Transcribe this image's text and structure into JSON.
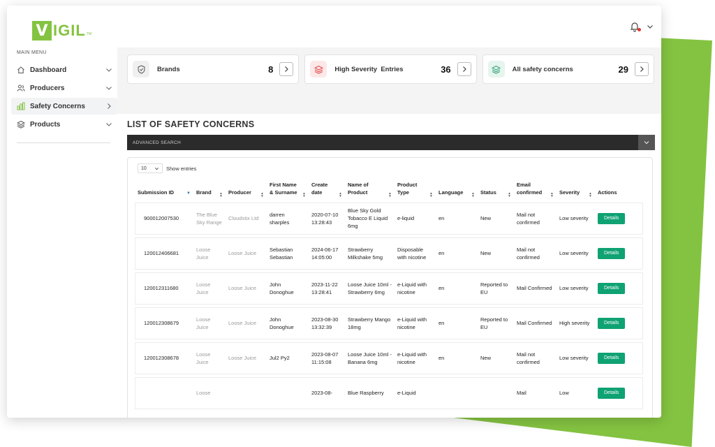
{
  "brand": {
    "logo_letter": "V",
    "logo_text": "IGIL",
    "logo_tm": "TM",
    "accent": "#84c341"
  },
  "sidebar": {
    "menu_label": "MAIN MENU",
    "items": [
      {
        "label": "Dashboard",
        "icon": "home-icon",
        "chevron": "down"
      },
      {
        "label": "Producers",
        "icon": "users-icon",
        "chevron": "down"
      },
      {
        "label": "Safety Concerns",
        "icon": "chart-icon",
        "chevron": "right",
        "active": true
      },
      {
        "label": "Products",
        "icon": "layers-icon",
        "chevron": "down"
      }
    ]
  },
  "cards": [
    {
      "label": "Brands",
      "count": "8",
      "icon": "shield-icon"
    },
    {
      "label": "High Severity  Entries",
      "count": "36",
      "icon": "layers-icon",
      "color": "#e05050"
    },
    {
      "label": "All safety concerns",
      "count": "29",
      "icon": "layers-icon",
      "color": "#3aa57a"
    }
  ],
  "page_title": "LIST OF SAFETY CONCERNS",
  "advanced_search": "ADVANCED SEARCH",
  "entries": {
    "value": "10",
    "label": "Show entries"
  },
  "table": {
    "headers": [
      {
        "label": "Submission ID",
        "sort": "active"
      },
      {
        "label": "Brand",
        "sort": "both"
      },
      {
        "label": "Producer",
        "sort": "both"
      },
      {
        "label": "First Name & Surname",
        "sort": "both"
      },
      {
        "label": "Create date",
        "sort": "both"
      },
      {
        "label": "Name of Product",
        "sort": "both"
      },
      {
        "label": "Product Type",
        "sort": "both"
      },
      {
        "label": "Language",
        "sort": "both"
      },
      {
        "label": "Status",
        "sort": "both"
      },
      {
        "label": "Email confirmed",
        "sort": "both"
      },
      {
        "label": "Severity",
        "sort": "both"
      },
      {
        "label": "Actions",
        "sort": "none"
      }
    ],
    "action_label": "Details",
    "rows": [
      {
        "id": "900012007530",
        "brand": "The Blue Sky Range",
        "producer": "Cloudstix Ltd",
        "name": "darren sharples",
        "date": "2020-07-10 13:28:43",
        "product": "Blue Sky Gold Tobacco E Liquid 6mg",
        "type": "e-liquid",
        "lang": "en",
        "status": "New",
        "email": "Mail not confirmed",
        "severity": "Low severity"
      },
      {
        "id": "120012406681",
        "brand": "Loose Juice",
        "producer": "Loose Juice",
        "name": "Sebastian Sebastian",
        "date": "2024-06-17 14:05:00",
        "product": "Strawberry Milkshake 5mg",
        "type": "Disposable with nicotine",
        "lang": "en",
        "status": "New",
        "email": "Mail not confirmed",
        "severity": "Low severity"
      },
      {
        "id": "120012311680",
        "brand": "Loose Juice",
        "producer": "Loose Juice",
        "name": "John Donoghue",
        "date": "2023-11-22 13:28:41",
        "product": "Loose Juice 10ml - Strawberry 6mg",
        "type": "e-Liquid with nicotine",
        "lang": "en",
        "status": "Reported to EU",
        "email": "Mail Confirmed",
        "severity": "Low severity"
      },
      {
        "id": "120012308679",
        "brand": "Loose Juice",
        "producer": "Loose Juice",
        "name": "John Donoghue",
        "date": "2023-08-30 13:32:39",
        "product": "Strawberry Mango 18mg",
        "type": "e-Liquid with nicotine",
        "lang": "en",
        "status": "Reported to EU",
        "email": "Mail Confirmed",
        "severity": "High severity"
      },
      {
        "id": "120012308678",
        "brand": "Loose Juice",
        "producer": "Loose Juice",
        "name": "Jul2 Py2",
        "date": "2023-08-07 11:15:08",
        "product": "Loose Juice 10ml - Banana 6mg",
        "type": "e-Liquid with nicotine",
        "lang": "en",
        "status": "New",
        "email": "Mail not confirmed",
        "severity": "Low severity"
      },
      {
        "id": "",
        "brand": "Loose",
        "producer": "",
        "name": "",
        "date": "2023-08-",
        "product": "Blue Raspberry",
        "type": "e-Liquid",
        "lang": "",
        "status": "",
        "email": "Mail",
        "severity": "Low"
      }
    ]
  }
}
